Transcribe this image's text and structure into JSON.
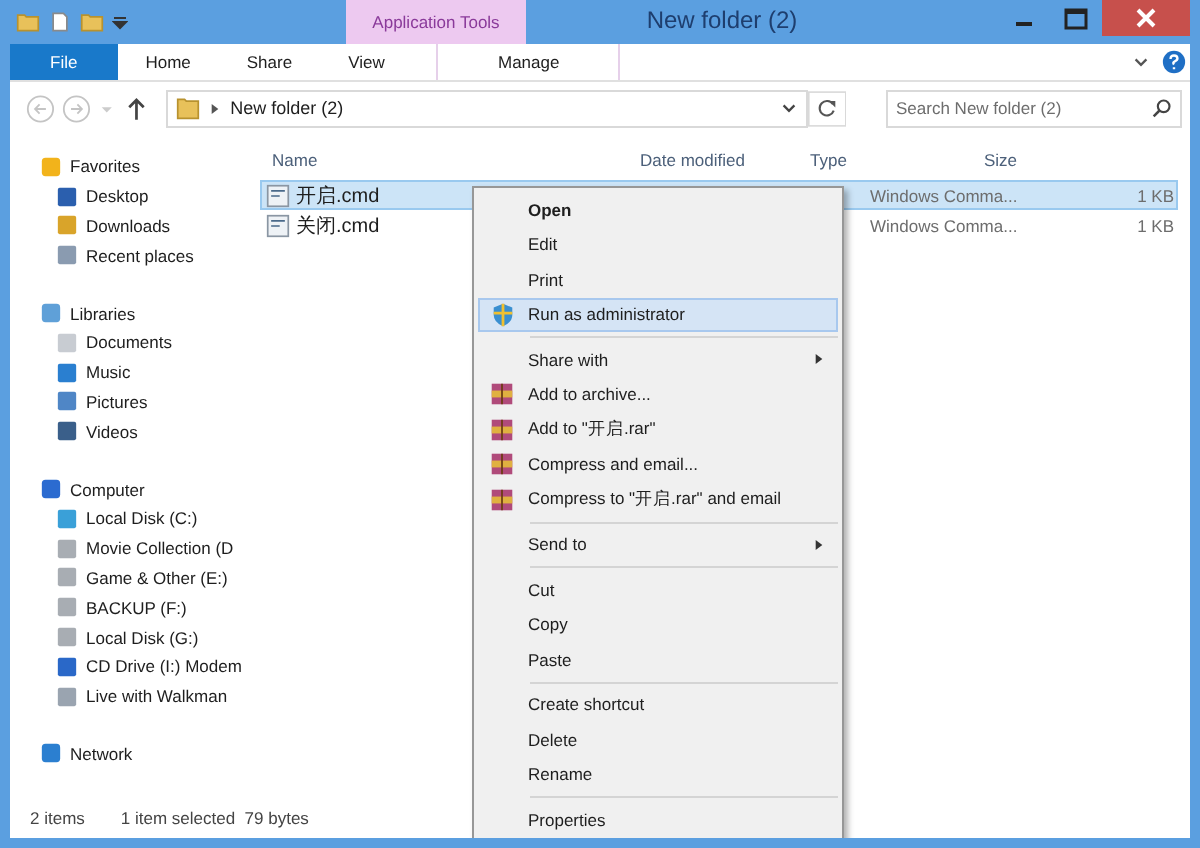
{
  "window": {
    "title": "New folder (2)",
    "context_tab": "Application Tools"
  },
  "ribbon_tabs": [
    {
      "label": "File",
      "kind": "file",
      "selected": false
    },
    {
      "label": "Home",
      "kind": "tab",
      "selected": false
    },
    {
      "label": "Share",
      "kind": "tab",
      "selected": false
    },
    {
      "label": "View",
      "kind": "tab",
      "selected": false
    },
    {
      "label": "Manage",
      "kind": "context",
      "selected": false
    }
  ],
  "address": {
    "path": "New folder (2)",
    "search_placeholder": "Search New folder (2)"
  },
  "sidebar": [
    {
      "label": "Favorites",
      "children": [
        {
          "label": "Desktop"
        },
        {
          "label": "Downloads"
        },
        {
          "label": "Recent places"
        }
      ]
    },
    {
      "label": "Libraries",
      "children": [
        {
          "label": "Documents"
        },
        {
          "label": "Music"
        },
        {
          "label": "Pictures"
        },
        {
          "label": "Videos"
        }
      ]
    },
    {
      "label": "Computer",
      "children": [
        {
          "label": "Local Disk (C:)"
        },
        {
          "label": "Movie Collection (D"
        },
        {
          "label": "Game & Other (E:)"
        },
        {
          "label": "BACKUP (F:)"
        },
        {
          "label": "Local Disk (G:)"
        },
        {
          "label": "CD Drive (I:) Modem"
        },
        {
          "label": "Live with Walkman"
        }
      ]
    },
    {
      "label": "Network"
    }
  ],
  "table": {
    "columns": [
      "Name",
      "Date modified",
      "Type",
      "Size"
    ],
    "rows": [
      {
        "name": "开启.cmd",
        "type": "Windows Comma...",
        "size": "1 KB",
        "selected": true
      },
      {
        "name": "关闭.cmd",
        "type": "Windows Comma...",
        "size": "1 KB",
        "selected": false
      }
    ]
  },
  "context_menu": [
    [
      {
        "label": "Open",
        "kind": "default",
        "submenu": false,
        "selected": false
      },
      {
        "label": "Edit",
        "kind": "plain",
        "submenu": false,
        "selected": false
      },
      {
        "label": "Print",
        "kind": "plain",
        "submenu": false,
        "selected": false
      },
      {
        "label": "Run as administrator",
        "kind": "shield",
        "submenu": false,
        "selected": true
      }
    ],
    [
      {
        "label": "Share with",
        "kind": "plain",
        "submenu": true,
        "selected": false
      },
      {
        "label": "Add to archive...",
        "kind": "archive",
        "submenu": false,
        "selected": false
      },
      {
        "label": "Add to \"开启.rar\"",
        "kind": "archive",
        "submenu": false,
        "selected": false
      },
      {
        "label": "Compress and email...",
        "kind": "archive",
        "submenu": false,
        "selected": false
      },
      {
        "label": "Compress to \"开启.rar\" and email",
        "kind": "archive",
        "submenu": false,
        "selected": false
      }
    ],
    [
      {
        "label": "Send to",
        "kind": "plain",
        "submenu": true,
        "selected": false
      }
    ],
    [
      {
        "label": "Cut",
        "kind": "plain",
        "submenu": false,
        "selected": false
      },
      {
        "label": "Copy",
        "kind": "plain",
        "submenu": false,
        "selected": false
      },
      {
        "label": "Paste",
        "kind": "plain",
        "submenu": false,
        "selected": false
      }
    ],
    [
      {
        "label": "Create shortcut",
        "kind": "plain",
        "submenu": false,
        "selected": false
      },
      {
        "label": "Delete",
        "kind": "plain",
        "submenu": false,
        "selected": false
      },
      {
        "label": "Rename",
        "kind": "plain",
        "submenu": false,
        "selected": false
      }
    ],
    [
      {
        "label": "Properties",
        "kind": "plain",
        "submenu": false,
        "selected": false
      }
    ]
  ],
  "status_bar": {
    "items": "2 items",
    "selection": "1 item selected  79 bytes"
  }
}
